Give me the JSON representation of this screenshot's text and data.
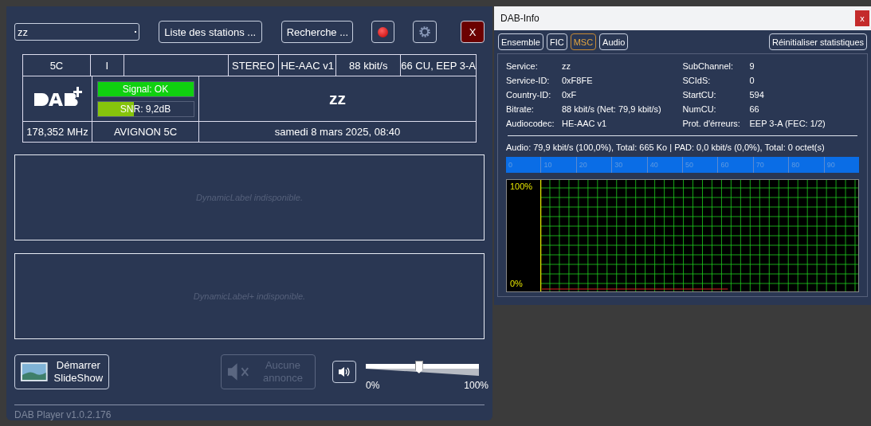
{
  "player": {
    "station_select": {
      "value": "zz"
    },
    "buttons": {
      "station_list": "Liste des stations ...",
      "search": "Recherche ...",
      "close": "X"
    },
    "record": {
      "on": true
    },
    "info_left": [
      "5C",
      "I"
    ],
    "info_right": [
      "STEREO",
      "HE-AAC v1",
      "88 kbit/s",
      "66 CU, EEP 3-A"
    ],
    "signal": {
      "label": "Signal: OK",
      "level": 1
    },
    "snr": {
      "label": "SNR: 9,2dB",
      "level": 0.38
    },
    "service_name": "zz",
    "frequency": "178,352 MHz",
    "ensemble": "AVIGNON 5C",
    "datetime": "samedi 8 mars 2025, 08:40",
    "dynamic_label": "DynamicLabel indisponible.",
    "dynamic_label_plus": "DynamicLabel+ indisponible.",
    "slideshow_button": "Démarrer SlideShow",
    "announcement_button": {
      "label": "Aucune annonce",
      "disabled": true
    },
    "volume": {
      "level": 0.47,
      "min_label": "0%",
      "max_label": "100%"
    },
    "version": "DAB Player v1.0.2.176"
  },
  "dab_info": {
    "title": "DAB-Info",
    "close": "x",
    "tabs": [
      {
        "label": "Ensemble",
        "selected": false
      },
      {
        "label": "FIC",
        "selected": false
      },
      {
        "label": "MSC",
        "selected": true
      },
      {
        "label": "Audio",
        "selected": false
      }
    ],
    "reset_button": "Réinitialiser statistiques",
    "left_fields": [
      {
        "label": "Service:",
        "value": "zz"
      },
      {
        "label": "Service-ID:",
        "value": "0xF8FE"
      },
      {
        "label": "Country-ID:",
        "value": "0xF"
      },
      {
        "label": "Bitrate:",
        "value": "88 kbit/s (Net: 79,9 kbit/s)"
      },
      {
        "label": "Audiocodec:",
        "value": "HE-AAC v1"
      }
    ],
    "right_fields": [
      {
        "label": "SubChannel:",
        "value": "9"
      },
      {
        "label": "SCIdS:",
        "value": "0"
      },
      {
        "label": "StartCU:",
        "value": "594"
      },
      {
        "label": "NumCU:",
        "value": "66"
      },
      {
        "label": "Prot. d'érreurs:",
        "value": "EEP 3-A (FEC: 1/2)"
      }
    ],
    "summary": "Audio: 79,9 kbit/s (100,0%), Total: 665 Ko | PAD: 0,0 kbit/s (0,0%), Total: 0 octet(s)",
    "usage_meter": {
      "level": 1,
      "ticks": [
        "0",
        "10",
        "20",
        "30",
        "40",
        "50",
        "60",
        "70",
        "80",
        "90"
      ]
    },
    "graph": {
      "top_label": "100%",
      "bottom_label": "0%"
    }
  }
}
